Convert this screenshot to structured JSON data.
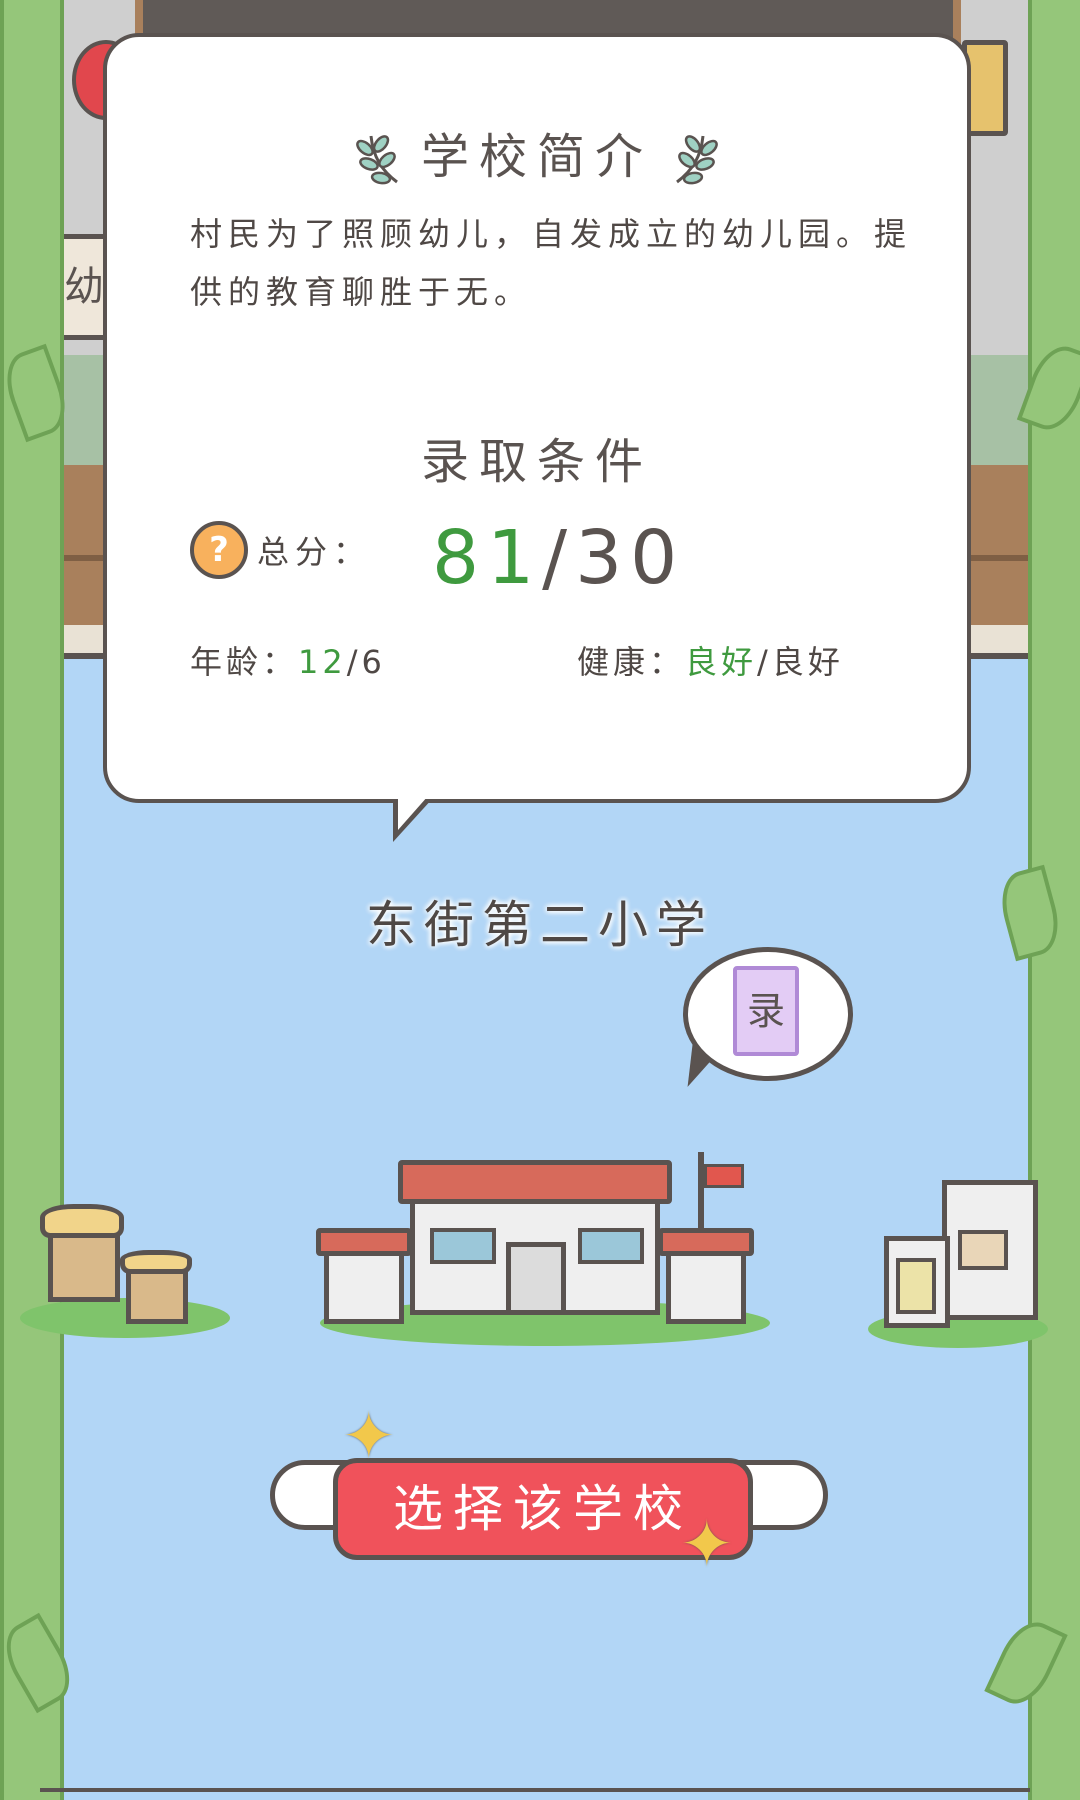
{
  "background": {
    "side_sign_text": "幼"
  },
  "intro": {
    "title": "学校简介",
    "text": "村民为了照顾幼儿，自发成立的幼儿园。提供的教育聊胜于无。"
  },
  "requirements": {
    "title": "录取条件",
    "help_icon_label": "?",
    "total_label": "总分：",
    "score_current": "81",
    "score_required": "/30",
    "age_label": "年龄：",
    "age_current": "12",
    "age_required": "/6",
    "health_label": "健康：",
    "health_current": "良好",
    "health_required": "/良好"
  },
  "school": {
    "name": "东街第二小学",
    "bubble_text": "录"
  },
  "actions": {
    "select_label": "选择该学校"
  },
  "colors": {
    "sky": "#b2d6f6",
    "accent_green": "#3f9a3f",
    "button_red": "#f0525b",
    "outline": "#5a5350"
  }
}
